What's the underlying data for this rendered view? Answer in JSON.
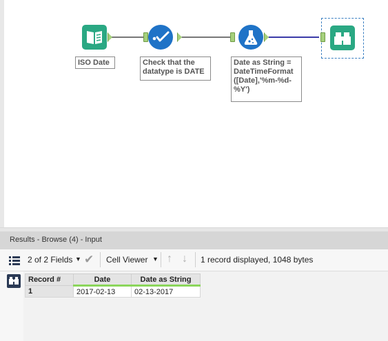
{
  "workflow": {
    "annotations": {
      "input": "ISO Date",
      "select": "Check that the\ndatatype is DATE",
      "formula": "Date as String =\nDateTimeFormat\n([Date],'%m-%d-\n%Y')"
    }
  },
  "results": {
    "header": "Results - Browse (4) - Input",
    "toolbar": {
      "fields": "2 of 2 Fields",
      "viewer": "Cell Viewer",
      "info": "1 record displayed, 1048 bytes"
    },
    "table": {
      "columns": [
        "Record #",
        "Date",
        "Date as String"
      ],
      "rows": [
        {
          "record": "1",
          "date": "2017-02-13",
          "date_string": "02-13-2017"
        }
      ]
    }
  },
  "colors": {
    "input_tool": "#2aa883",
    "select_tool": "#1f73c7",
    "formula_tool": "#1f73c7",
    "browse_tool": "#2aa883",
    "anchor": "#a5d07c"
  }
}
